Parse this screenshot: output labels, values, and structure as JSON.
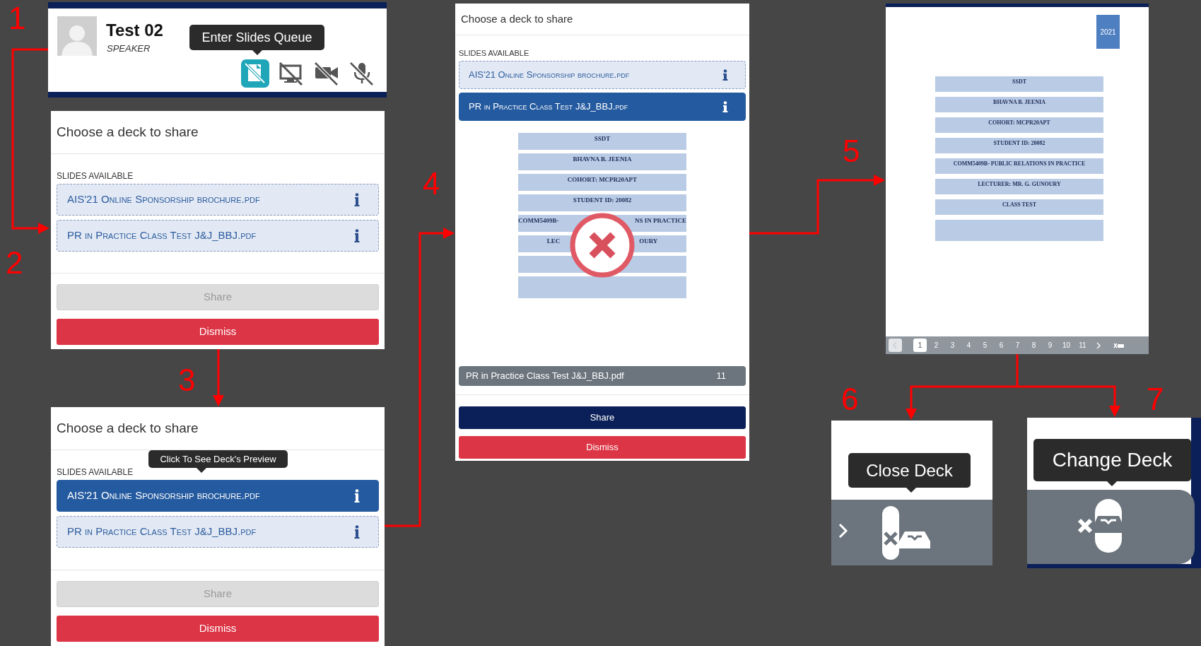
{
  "step_numbers": [
    "1",
    "2",
    "3",
    "4",
    "5",
    "6",
    "7"
  ],
  "speaker_card": {
    "name": "Test 02",
    "role": "SPEAKER",
    "tooltip": "Enter Slides Queue",
    "controls": [
      {
        "kind": "slides",
        "selected": true
      },
      {
        "kind": "screen",
        "selected": false
      },
      {
        "kind": "camera",
        "selected": false
      },
      {
        "kind": "mic",
        "selected": false
      }
    ]
  },
  "dialogs": [
    {
      "title": "Choose a deck to share",
      "section_label": "SLIDES AVAILABLE",
      "decks": [
        {
          "name": "AIS'21 Online Sponsorship brochure.pdf",
          "selected": false
        },
        {
          "name": "PR in Practice Class Test J&J_BBJ.pdf",
          "selected": false
        }
      ],
      "share": {
        "label": "Share",
        "disabled": true
      },
      "dismiss": "Dismiss"
    },
    {
      "title": "Choose a deck to share",
      "tooltip": "Click To See Deck's Preview",
      "section_label": "SLIDES AVAILABLE",
      "decks": [
        {
          "name": "AIS'21 Online Sponsorship brochure.pdf",
          "selected": true
        },
        {
          "name": "PR in Practice Class Test J&J_BBJ.pdf",
          "selected": false
        }
      ],
      "share": {
        "label": "Share",
        "disabled": true
      },
      "dismiss": "Dismiss"
    },
    {
      "title": "Choose a deck to share",
      "section_label": "SLIDES AVAILABLE",
      "decks": [
        {
          "name": "AIS'21 Online Sponsorship brochure.pdf",
          "selected": false
        },
        {
          "name": "PR in Practice Class Test J&J_BBJ.pdf",
          "selected": true
        }
      ],
      "preview": {
        "rows": [
          {
            "kind": "text",
            "text": "SSDT"
          },
          {
            "kind": "text",
            "text": "BHAVNA B. JEENIA"
          },
          {
            "kind": "text",
            "text": "COHORT: MCPR20APT"
          },
          {
            "kind": "text",
            "text": "STUDENT ID: 20082"
          },
          {
            "kind": "split",
            "left": "COMM5409B-",
            "right": "NS IN PRACTICE"
          },
          {
            "kind": "split",
            "left": "LEC",
            "right": "OURY"
          },
          {
            "kind": "blank"
          },
          {
            "kind": "blank"
          }
        ]
      },
      "file_bar": {
        "name": "PR in Practice Class Test J&J_BBJ.pdf",
        "pages": "11"
      },
      "share": {
        "label": "Share",
        "disabled": false
      },
      "dismiss": "Dismiss"
    }
  ],
  "slide_viewer": {
    "year": "2021",
    "rows": [
      {
        "kind": "text",
        "text": "SSDT"
      },
      {
        "kind": "text",
        "text": "BHAVNA B. JEENIA"
      },
      {
        "kind": "text",
        "text": "COHORT: MCPR20APT"
      },
      {
        "kind": "text",
        "text": "STUDENT ID: 20082"
      },
      {
        "kind": "text",
        "text": "COMM5409B- PUBLIC RELATIONS IN PRACTICE"
      },
      {
        "kind": "text",
        "text": "LECTURER: MR. G. GUNOURY"
      },
      {
        "kind": "text",
        "text": "CLASS TEST"
      },
      {
        "kind": "blank"
      }
    ],
    "pages": [
      {
        "label": "1",
        "selected": true
      },
      {
        "label": "2",
        "selected": false
      },
      {
        "label": "3",
        "selected": false
      },
      {
        "label": "4",
        "selected": false
      },
      {
        "label": "5",
        "selected": false
      },
      {
        "label": "6",
        "selected": false
      },
      {
        "label": "7",
        "selected": false
      },
      {
        "label": "8",
        "selected": false
      },
      {
        "label": "9",
        "selected": false
      },
      {
        "label": "10",
        "selected": false
      },
      {
        "label": "11",
        "selected": false
      }
    ]
  },
  "close_deck": {
    "tooltip": "Close Deck"
  },
  "change_deck": {
    "tooltip": "Change Deck"
  }
}
